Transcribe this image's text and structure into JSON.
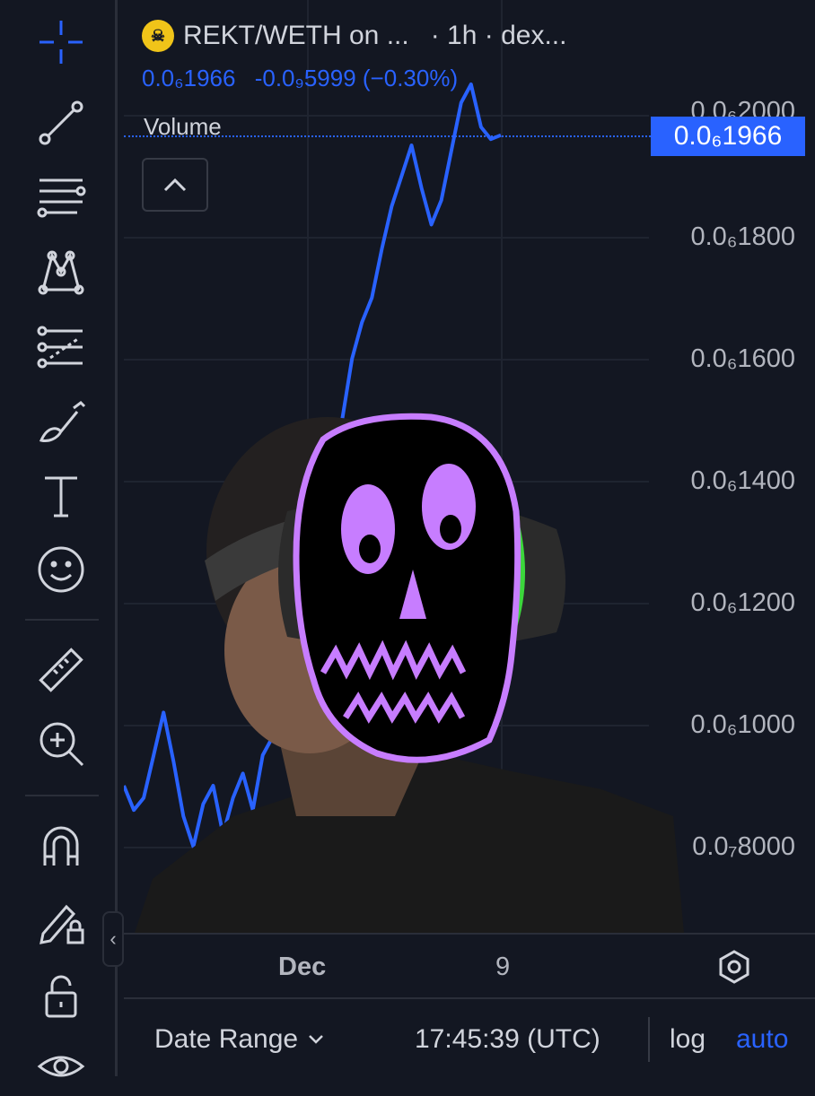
{
  "header": {
    "symbol": "REKT/WETH on ...",
    "interval_source": "· 1h · dex...",
    "logo_text": "REKT"
  },
  "ohlc": {
    "price": "0.0₆1966",
    "change": "-0.0₉5999 (−0.30%)"
  },
  "indicator": {
    "volume_label": "Volume"
  },
  "price_axis": {
    "labels": [
      "0.0₆2000",
      "0.0₆1800",
      "0.0₆1600",
      "0.0₆1400",
      "0.0₆1200",
      "0.0₆1000",
      "0.0₇8000"
    ],
    "last_price": "0.0₆1966"
  },
  "time_axis": {
    "labels": [
      "Dec",
      "9"
    ]
  },
  "bottom_bar": {
    "date_range": "Date Range",
    "clock": "17:45:39 (UTC)",
    "log": "log",
    "auto": "auto"
  },
  "toolbar": {
    "icons": [
      "crosshair-icon",
      "trend-line-icon",
      "fib-retracement-icon",
      "pattern-icon",
      "forecast-icon",
      "brush-icon",
      "text-icon",
      "emoji-icon",
      "ruler-icon",
      "zoom-in-icon",
      "magnet-icon",
      "lock-drawing-icon",
      "lock-icon",
      "eye-icon"
    ]
  },
  "colors": {
    "background": "#131722",
    "accent": "#2962ff",
    "line": "#2962ff",
    "text": "#d1d4dc",
    "overlay_outline": "#c77dff"
  },
  "chart_data": {
    "type": "line",
    "title": "",
    "xlabel": "",
    "ylabel": "",
    "ylim": [
      7.5e-07,
      2.1e-06
    ],
    "x_ticks": [
      "Dec",
      "9"
    ],
    "series": [
      {
        "values": [
          9e-07,
          8.6e-07,
          8.8e-07,
          9.5e-07,
          1.02e-06,
          9.4e-07,
          8.5e-07,
          8e-07,
          8.7e-07,
          9e-07,
          8.2e-07,
          8.8e-07,
          9.2e-07,
          8.6e-07,
          9.5e-07,
          9.8e-07,
          1.04e-06,
          1.12e-06,
          1.2e-06,
          1.28e-06,
          1.36e-06,
          1.45e-06,
          1.5e-06,
          1.6e-06,
          1.66e-06,
          1.7e-06,
          1.78e-06,
          1.85e-06,
          1.9e-06,
          1.95e-06,
          1.88e-06,
          1.82e-06,
          1.86e-06,
          1.94e-06,
          2.02e-06,
          2.05e-06,
          1.98e-06,
          1.96e-06,
          1.9666e-06
        ]
      }
    ]
  }
}
